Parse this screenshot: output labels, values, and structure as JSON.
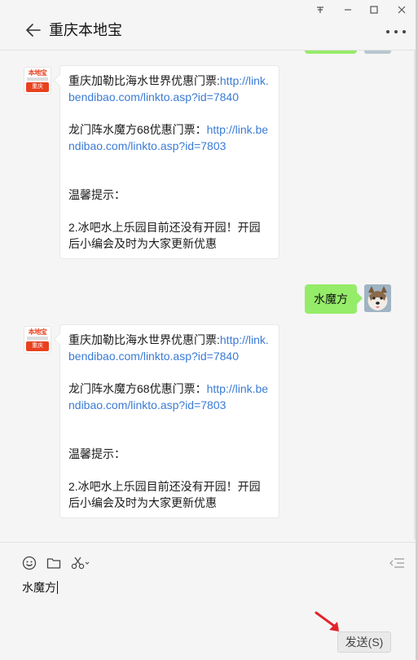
{
  "titlebar": {
    "title": "重庆本地宝",
    "controls": [
      "pin-icon",
      "minimize-icon",
      "maximize-icon",
      "close-icon"
    ]
  },
  "messages": [
    {
      "from": "other",
      "sender_avatar": {
        "logo_text": "本地宝",
        "city": "重庆"
      },
      "line1_text": "重庆加勒比海水世界优惠门票:",
      "line1_link": "http://link.bendibao.com/linkto.asp?id=7840",
      "line2_text": "龙门阵水魔方68优惠门票：",
      "line2_link": "http://link.bendibao.com/linkto.asp?id=7803",
      "tip_title": "温馨提示：",
      "tip_body": "2.冰吧水上乐园目前还没有开园！开园后小编会及时为大家更新优惠"
    },
    {
      "from": "me",
      "text": "水魔方"
    },
    {
      "from": "other",
      "sender_avatar": {
        "logo_text": "本地宝",
        "city": "重庆"
      },
      "line1_text": "重庆加勒比海水世界优惠门票:",
      "line1_link": "http://link.bendibao.com/linkto.asp?id=7840",
      "line2_text": "龙门阵水魔方68优惠门票：",
      "line2_link": "http://link.bendibao.com/linkto.asp?id=7803",
      "tip_title": "温馨提示：",
      "tip_body": "2.冰吧水上乐园目前还没有开园！开园后小编会及时为大家更新优惠"
    }
  ],
  "toolbar": {
    "icons": [
      "emoji-icon",
      "folder-icon",
      "scissors-icon",
      "chat-history-icon"
    ]
  },
  "composer": {
    "value": "水魔方",
    "send_label": "发送(S)"
  },
  "colors": {
    "my_bubble": "#95ec69",
    "link": "#3a7bd5",
    "brand": "#e8411e"
  }
}
